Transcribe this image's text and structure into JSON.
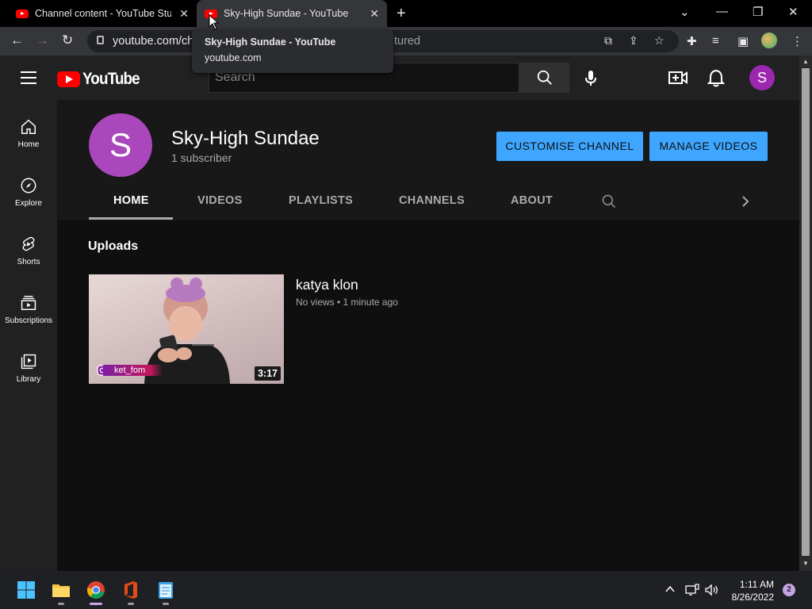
{
  "browser": {
    "tabs": [
      {
        "title": "Channel content - YouTube Studio",
        "active": false
      },
      {
        "title": "Sky-High Sundae - YouTube",
        "active": true
      }
    ],
    "url": "youtube.com/ch",
    "url_tail": "tured",
    "tooltip": {
      "title": "Sky-High Sundae - YouTube",
      "host": "youtube.com"
    }
  },
  "masthead": {
    "logo_text": "YouTube",
    "search_placeholder": "Search",
    "avatar_letter": "S"
  },
  "sidebar": {
    "items": [
      {
        "label": "Home",
        "icon": "home-icon"
      },
      {
        "label": "Explore",
        "icon": "compass-icon"
      },
      {
        "label": "Shorts",
        "icon": "shorts-icon"
      },
      {
        "label": "Subscriptions",
        "icon": "subscriptions-icon"
      },
      {
        "label": "Library",
        "icon": "library-icon"
      }
    ]
  },
  "channel": {
    "avatar_letter": "S",
    "name": "Sky-High Sundae",
    "subscribers": "1 subscriber",
    "customise_label": "CUSTOMISE CHANNEL",
    "manage_label": "MANAGE VIDEOS",
    "tabs": [
      "HOME",
      "VIDEOS",
      "PLAYLISTS",
      "CHANNELS",
      "ABOUT"
    ],
    "active_tab": "HOME"
  },
  "content": {
    "section_title": "Uploads",
    "video": {
      "title": "katya klon",
      "meta": "No views • 1 minute ago",
      "duration": "3:17",
      "overlay_tag": "ket_fom"
    }
  },
  "taskbar": {
    "time": "1:11 AM",
    "date": "8/26/2022",
    "notification_count": "2"
  },
  "colors": {
    "accent_blue": "#3ea6ff",
    "brand_red": "#ff0000",
    "avatar_purple": "#ab47bc"
  }
}
